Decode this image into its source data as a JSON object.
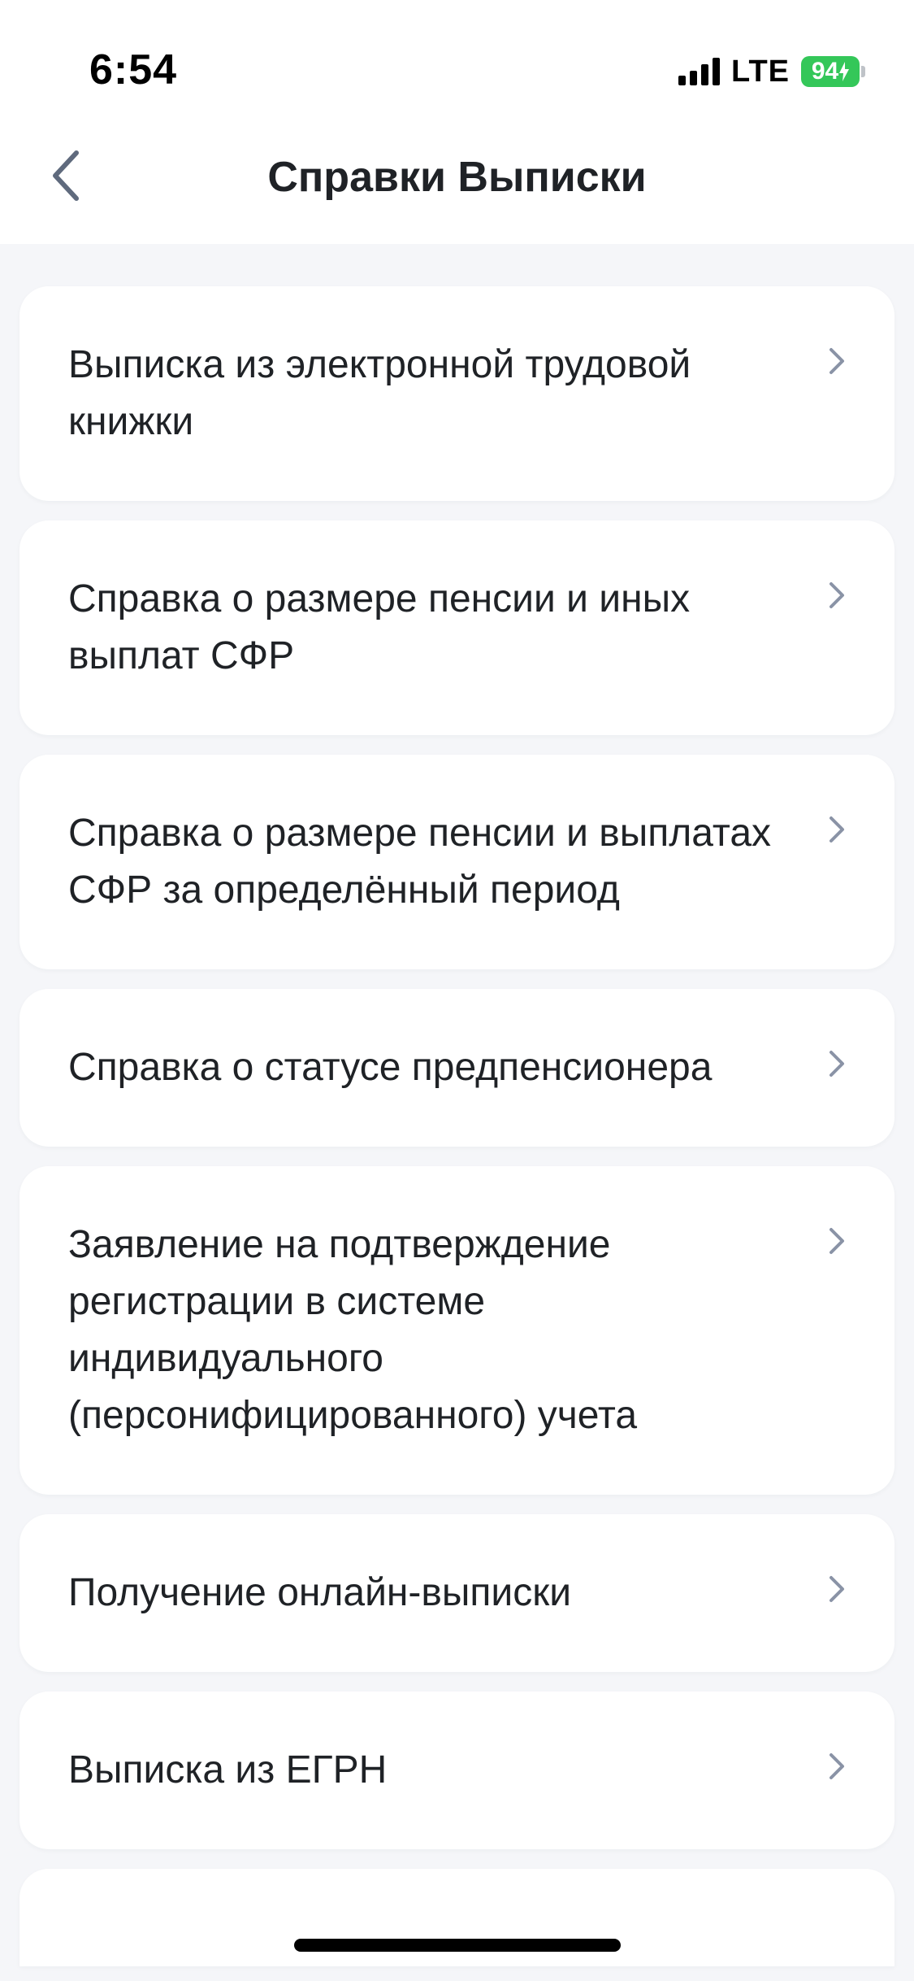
{
  "status_bar": {
    "time": "6:54",
    "network": "LTE",
    "battery_percent": "94",
    "battery_charging": true,
    "battery_color": "#34c759"
  },
  "nav": {
    "back_icon": "chevron-left-icon",
    "title": "Справки Выписки"
  },
  "items": [
    {
      "label": "Выписка из электронной трудовой книжки"
    },
    {
      "label": "Справка о размере пенсии и иных выплат СФР"
    },
    {
      "label": "Справка о размере пенсии и выплатах СФР за определённый период"
    },
    {
      "label": "Справка о статусе предпенсионера"
    },
    {
      "label": "Заявление на подтверждение регистрации в системе индивидуального (персонифицированного) учета"
    },
    {
      "label": "Получение онлайн-выписки"
    },
    {
      "label": "Выписка из ЕГРН"
    }
  ],
  "item_icon": "chevron-right-icon",
  "colors": {
    "background": "#f5f6f9",
    "card": "#ffffff",
    "text": "#1f2226",
    "chevron": "#8a93a6"
  }
}
